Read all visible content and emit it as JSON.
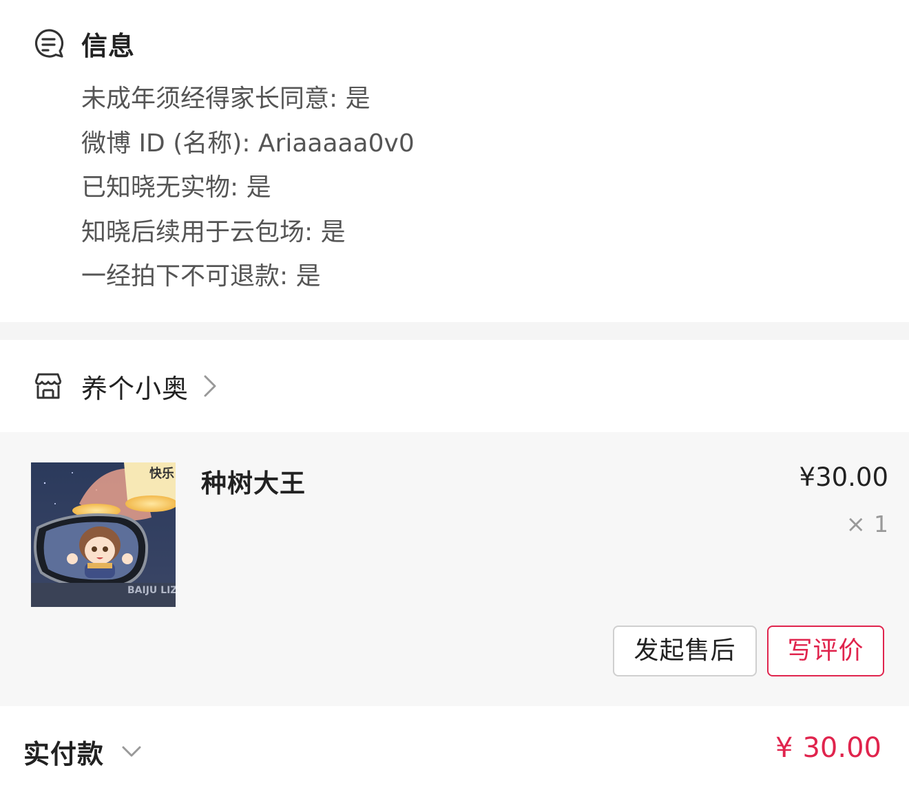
{
  "info": {
    "title": "信息",
    "rows": [
      "未成年须经得家长同意: 是",
      "微博 ID (名称): Ariaaaaa0v0",
      "已知晓无实物: 是",
      "知晓后续用于云包场: 是",
      "一经拍下不可退款: 是"
    ]
  },
  "shop": {
    "name": "养个小奥"
  },
  "product": {
    "name": "种树大王",
    "price": "¥30.00",
    "qty_symbol": "×",
    "qty": "1",
    "thumb_text_top": "快乐",
    "thumb_text_bottom": "BAIJU LIZHEI"
  },
  "actions": {
    "after_sale": "发起售后",
    "review": "写评价"
  },
  "payment": {
    "label": "实付款",
    "currency": "¥",
    "amount": "30.00"
  },
  "colors": {
    "accent": "#e0244d",
    "section_gap": "#f5f5f5",
    "card_bg": "#f7f7f7"
  },
  "icons": {
    "info": "message-note-icon",
    "shop": "store-icon",
    "shop_chevron": "chevron-right-icon",
    "payment_chevron": "chevron-down-icon"
  }
}
